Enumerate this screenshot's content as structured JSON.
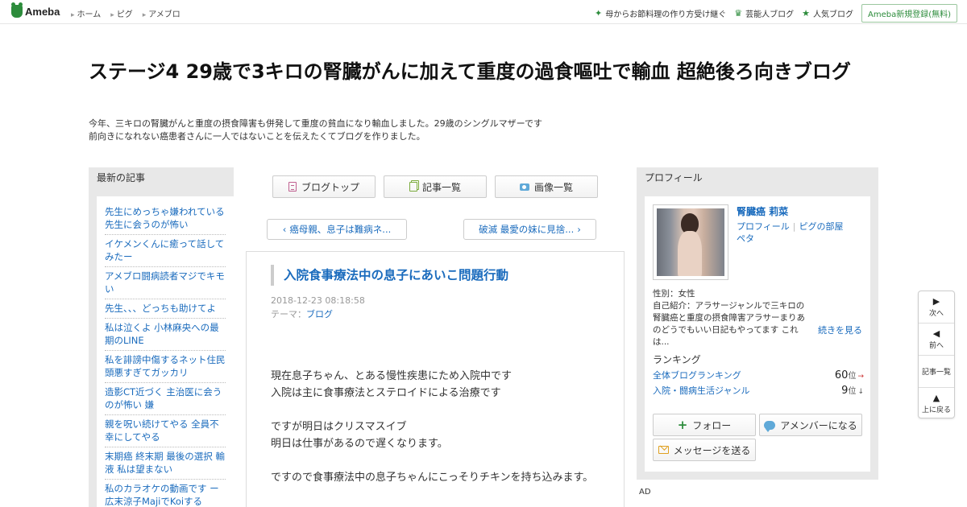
{
  "header": {
    "logo": "Ameba",
    "nav": [
      "ホーム",
      "ピグ",
      "アメブロ"
    ],
    "right_links": [
      {
        "label": "母からお節料理の作り方受け継ぐ",
        "icon": "sparkle-icon"
      },
      {
        "label": "芸能人ブログ",
        "icon": "crown-icon"
      },
      {
        "label": "人気ブログ",
        "icon": "star-icon"
      }
    ],
    "register": "Ameba新規登録(無料)"
  },
  "blog": {
    "title": "ステージ4 29歳で3キロの腎臓がんに加えて重度の過食嘔吐で輸血 超絶後ろ向きブログ",
    "description": "今年、三キロの腎臓がんと重度の摂食障害も併発して重度の貧血になり輸血しました。29歳のシングルマザーです\n前向きになれない癌患者さんに一人ではないことを伝えたくてブログを作りました。"
  },
  "sidebar": {
    "heading": "最新の記事",
    "items": [
      "先生にめっちゃ嫌われている 先生に会うのが怖い",
      "イケメンくんに癒って話してみたー",
      "アメブロ闘病読者マジでキモい",
      "先生、、、どっちも助けてよ",
      "私は泣くよ 小林麻央への最期のLINE",
      "私を誹謗中傷するネット住民頭悪すぎてガッカリ",
      "造影CT近づく 主治医に会うのが怖い 嫌",
      "親を呪い続けてやる 全員不幸にしてやる",
      "末期癌 終末期 最後の選択 輸液 私は望まない",
      "私のカラオケの動画です ー広末涼子MajiでKoiする"
    ]
  },
  "toolbar": {
    "blog_top": "ブログトップ",
    "articles": "記事一覧",
    "images": "画像一覧"
  },
  "pager": {
    "prev": "癌母親、息子は難病ネ...",
    "next": "破滅 最愛の妹に見捨..."
  },
  "article": {
    "title": "入院食事療法中の息子にあいこ問題行動",
    "date": "2018-12-23 08:18:58",
    "theme_label": "テーマ：",
    "theme": "ブログ",
    "paragraphs": [
      [
        "現在息子ちゃん、とある慢性疾患にため入院中です",
        "入院は主に食事療法とステロイドによる治療です"
      ],
      [
        "ですが明日はクリスマスイブ",
        "明日は仕事があるので遅くなります。"
      ],
      [
        "ですので食事療法中の息子ちゃんにこっそりチキンを持ち込みます。"
      ]
    ]
  },
  "profile": {
    "heading": "プロフィール",
    "name": "腎臓癌 莉菜",
    "link_profile": "プロフィール",
    "link_pig": "ピグの部屋",
    "link_peta": "ペタ",
    "gender": "性別：女性",
    "intro": "自己紹介：アラサージャンルで三キロの腎臓癌と重度の摂食障害アラサーまりあのどうでもいい日記もやってます これは...",
    "more": "続きを見る",
    "ranking_heading": "ランキング",
    "rankings": [
      {
        "label": "全体ブログランキング",
        "value": "60",
        "unit": "位",
        "trend": "→"
      },
      {
        "label": "入院・闘病生活ジャンル",
        "value": "9",
        "unit": "位",
        "trend": "↓"
      }
    ],
    "follow": "フォロー",
    "amember": "アメンバーになる",
    "message": "メッセージを送る"
  },
  "ad": "AD",
  "floatnav": {
    "next": "次へ",
    "prev": "前へ",
    "list": "記事一覧",
    "top": "上に戻る"
  },
  "colors": {
    "brand": "#2d8c3c",
    "link": "#1a6bbd"
  }
}
